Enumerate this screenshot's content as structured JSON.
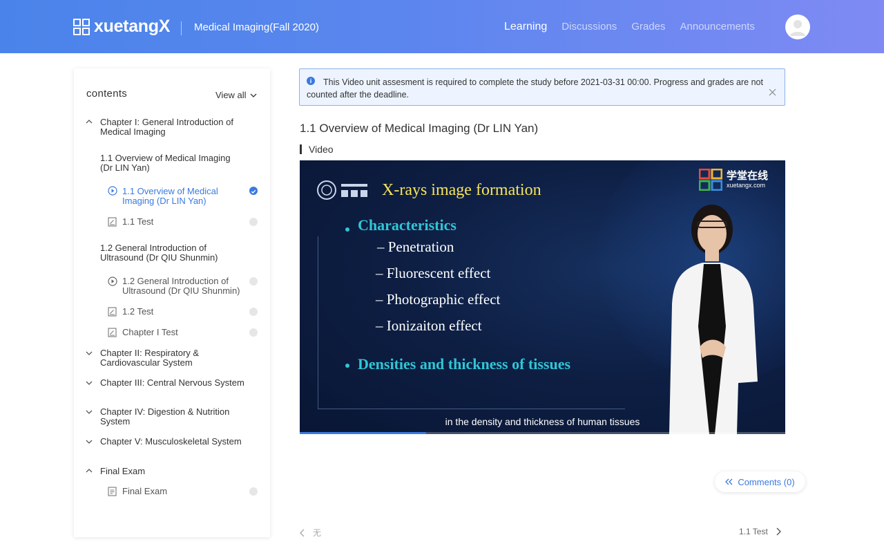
{
  "header": {
    "logo_text": "xuetangX",
    "course_title": "Medical Imaging(Fall 2020)",
    "nav": [
      "Learning",
      "Discussions",
      "Grades",
      "Announcements"
    ],
    "active_nav": "Learning",
    "avatar_icon": "user-avatar-icon"
  },
  "sidebar": {
    "title": "contents",
    "view_all": "View all",
    "chapter1": {
      "title": "Chapter I: General Introduction of Medical Imaging",
      "sec1": {
        "title": "1.1 Overview of Medical Imaging (Dr LIN Yan)",
        "unit_video": "1.1 Overview of Medical Imaging (Dr LIN Yan)",
        "unit_test": "1.1 Test"
      },
      "sec2": {
        "title": "1.2 General Introduction of Ultrasound (Dr QIU Shunmin)",
        "unit_video": "1.2 General Introduction of Ultrasound (Dr QIU Shunmin)",
        "unit_test": "1.2 Test"
      },
      "chapter_test": "Chapter I Test"
    },
    "chapter2": "Chapter II: Respiratory & Cardiovascular System",
    "chapter3": "Chapter III: Central Nervous System",
    "chapter4": "Chapter IV: Digestion & Nutrition System",
    "chapter5": "Chapter V: Musculoskeletal System",
    "final": {
      "title": "Final Exam",
      "unit": "Final Exam"
    }
  },
  "notice": {
    "text": "This Video unit assesment is required to complete the study before 2021-03-31 00:00. Progress and grades are not counted after the deadline."
  },
  "main": {
    "unit_title": "1.1 Overview of Medical Imaging (Dr LIN Yan)",
    "section_label": "Video"
  },
  "video": {
    "slide_title": "X-rays image formation",
    "heading1": "Characteristics",
    "items": [
      "Penetration",
      "Fluorescent effect",
      "Photographic effect",
      "Ionizaiton effect"
    ],
    "heading2": "Densities and thickness of tissues",
    "brand_cn": "学堂在线",
    "brand_en": "xuetangx.com",
    "subtitle": "in the density and thickness of human tissues",
    "progress": 0.26
  },
  "comments": {
    "label": "Comments (0)"
  },
  "pager": {
    "prev": "无",
    "next": "1.1 Test"
  },
  "colors": {
    "accent": "#3a79e0",
    "header_start": "#4a84ea",
    "header_end": "#7f8af4"
  }
}
